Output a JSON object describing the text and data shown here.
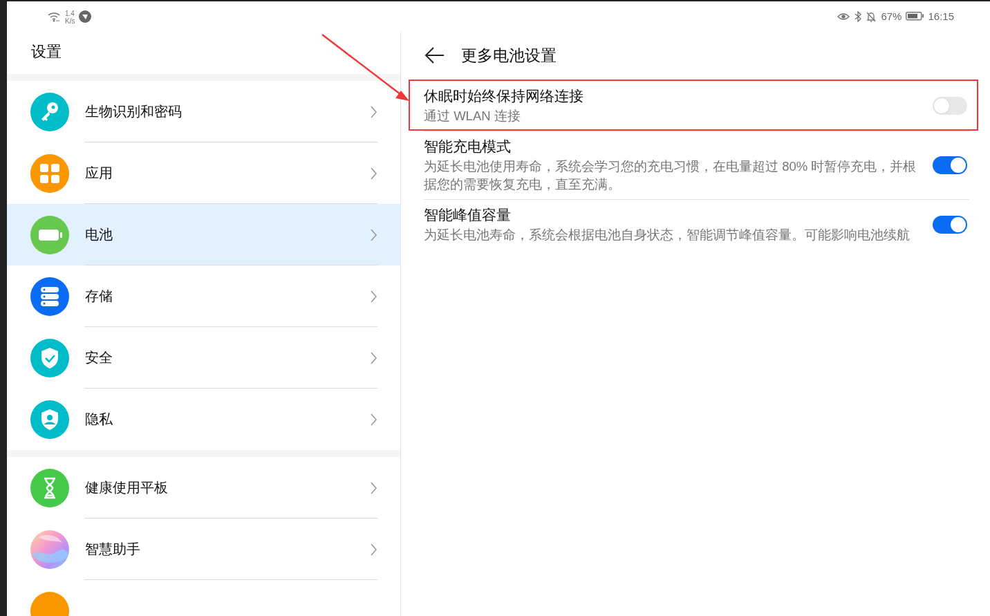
{
  "status_bar": {
    "net_speed_value": "1.4",
    "net_speed_unit": "K/s",
    "battery_percent": "67%",
    "time": "16:15"
  },
  "sidebar": {
    "title": "设置",
    "groups": [
      {
        "items": [
          {
            "label": "生物识别和密码",
            "kind": "key",
            "color": "#00bcc9",
            "selected": false
          },
          {
            "label": "应用",
            "kind": "apps",
            "color": "#fa9600",
            "selected": false
          },
          {
            "label": "电池",
            "kind": "battery",
            "color": "#66c84f",
            "selected": true
          },
          {
            "label": "存储",
            "kind": "storage",
            "color": "#0a6cf5",
            "selected": false
          },
          {
            "label": "安全",
            "kind": "shieldcheck",
            "color": "#00bcc9",
            "selected": false
          },
          {
            "label": "隐私",
            "kind": "shieldperson",
            "color": "#00bcc9",
            "selected": false
          }
        ]
      },
      {
        "items": [
          {
            "label": "健康使用平板",
            "kind": "hourglass",
            "color": "#45c94b",
            "selected": false
          },
          {
            "label": "智慧助手",
            "kind": "orb",
            "selected": false
          },
          {
            "kind": "partial",
            "color": "#fa9600",
            "selected": false
          }
        ]
      }
    ]
  },
  "detail": {
    "title": "更多电池设置",
    "items": [
      {
        "title": "休眠时始终保持网络连接",
        "subtitle": "通过 WLAN 连接",
        "on": false,
        "highlighted": true
      },
      {
        "title": "智能充电模式",
        "subtitle": "为延长电池使用寿命，系统会学习您的充电习惯，在电量超过 80% 时暂停充电，并根据您的需要恢复充电，直至充满。",
        "on": true,
        "highlighted": false
      },
      {
        "title": "智能峰值容量",
        "subtitle": "为延长电池寿命，系统会根据电池自身状态，智能调节峰值容量。可能影响电池续航",
        "on": true,
        "highlighted": false
      }
    ]
  }
}
